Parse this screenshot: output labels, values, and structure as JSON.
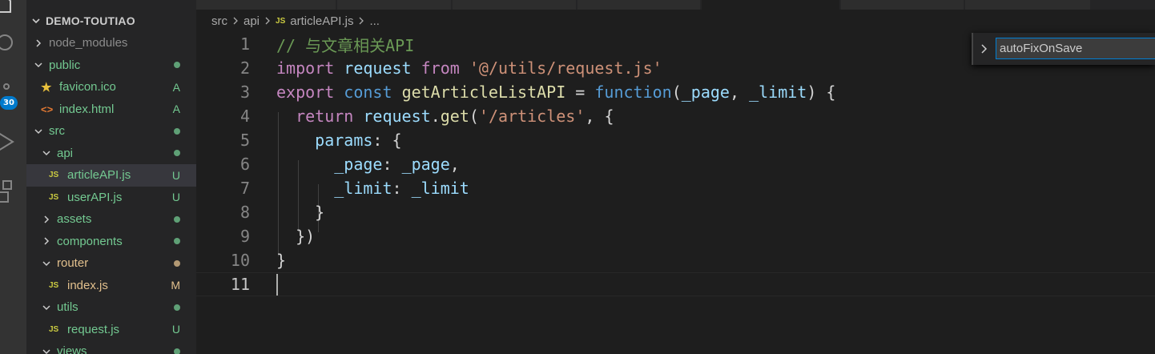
{
  "activity_bar": {
    "scm_badge": "30",
    "icons": [
      "explorer-icon",
      "search-icon",
      "source-control-icon",
      "run-debug-icon",
      "extensions-icon"
    ]
  },
  "explorer": {
    "title": "DEMO-TOUTIAO",
    "items": [
      {
        "label": "node_modules",
        "kind": "folder",
        "expanded": false,
        "depth": 1,
        "status": "",
        "color": "#8c8c8c"
      },
      {
        "label": "public",
        "kind": "folder",
        "expanded": true,
        "depth": 1,
        "status": "dot",
        "color": "#73c991"
      },
      {
        "label": "favicon.ico",
        "kind": "ico",
        "depth": 2,
        "status": "A",
        "color": "#73c991"
      },
      {
        "label": "index.html",
        "kind": "html",
        "depth": 2,
        "status": "A",
        "color": "#73c991"
      },
      {
        "label": "src",
        "kind": "folder",
        "expanded": true,
        "depth": 1,
        "status": "dot",
        "color": "#73c991"
      },
      {
        "label": "api",
        "kind": "folder",
        "expanded": true,
        "depth": 2,
        "status": "dot",
        "color": "#73c991"
      },
      {
        "label": "articleAPI.js",
        "kind": "js",
        "depth": 3,
        "status": "U",
        "color": "#73c991",
        "selected": true
      },
      {
        "label": "userAPI.js",
        "kind": "js",
        "depth": 3,
        "status": "U",
        "color": "#73c991"
      },
      {
        "label": "assets",
        "kind": "folder",
        "expanded": false,
        "depth": 2,
        "status": "dot",
        "color": "#73c991"
      },
      {
        "label": "components",
        "kind": "folder",
        "expanded": false,
        "depth": 2,
        "status": "dot",
        "color": "#73c991"
      },
      {
        "label": "router",
        "kind": "folder",
        "expanded": true,
        "depth": 2,
        "status": "dot",
        "color": "#e2c08d"
      },
      {
        "label": "index.js",
        "kind": "js",
        "depth": 3,
        "status": "M",
        "color": "#e2c08d"
      },
      {
        "label": "utils",
        "kind": "folder",
        "expanded": true,
        "depth": 2,
        "status": "dot",
        "color": "#73c991"
      },
      {
        "label": "request.js",
        "kind": "js",
        "depth": 3,
        "status": "U",
        "color": "#73c991"
      },
      {
        "label": "views",
        "kind": "folder",
        "expanded": true,
        "depth": 2,
        "status": "dot",
        "color": "#73c991"
      }
    ]
  },
  "breadcrumb": {
    "parts": [
      "src",
      "api",
      "articleAPI.js",
      "..."
    ],
    "file_badge": "JS"
  },
  "find_widget": {
    "value": "autoFixOnSave"
  },
  "editor": {
    "current_line": 11,
    "lines": [
      {
        "n": "1",
        "tokens": [
          [
            "c",
            "// 与文章相关API"
          ]
        ]
      },
      {
        "n": "2",
        "tokens": [
          [
            "k",
            "import"
          ],
          [
            "p",
            " "
          ],
          [
            "v",
            "request"
          ],
          [
            "p",
            " "
          ],
          [
            "k",
            "from"
          ],
          [
            "p",
            " "
          ],
          [
            "s",
            "'@/utils/request.js'"
          ]
        ]
      },
      {
        "n": "3",
        "tokens": [
          [
            "k",
            "export"
          ],
          [
            "p",
            " "
          ],
          [
            "d",
            "const"
          ],
          [
            "p",
            " "
          ],
          [
            "f",
            "getArticleListAPI"
          ],
          [
            "p",
            " = "
          ],
          [
            "d",
            "function"
          ],
          [
            "p",
            "("
          ],
          [
            "v",
            "_page"
          ],
          [
            "p",
            ", "
          ],
          [
            "v",
            "_limit"
          ],
          [
            "p",
            ") {"
          ]
        ]
      },
      {
        "n": "4",
        "tokens": [
          [
            "p",
            "  "
          ],
          [
            "k",
            "return"
          ],
          [
            "p",
            " "
          ],
          [
            "v",
            "request"
          ],
          [
            "p",
            "."
          ],
          [
            "f",
            "get"
          ],
          [
            "p",
            "("
          ],
          [
            "s",
            "'/articles'"
          ],
          [
            "p",
            ", {"
          ]
        ]
      },
      {
        "n": "5",
        "tokens": [
          [
            "p",
            "    "
          ],
          [
            "v",
            "params"
          ],
          [
            "p",
            ": {"
          ]
        ]
      },
      {
        "n": "6",
        "tokens": [
          [
            "p",
            "      "
          ],
          [
            "v",
            "_page"
          ],
          [
            "p",
            ": "
          ],
          [
            "v",
            "_page"
          ],
          [
            "p",
            ","
          ]
        ]
      },
      {
        "n": "7",
        "tokens": [
          [
            "p",
            "      "
          ],
          [
            "v",
            "_limit"
          ],
          [
            "p",
            ": "
          ],
          [
            "v",
            "_limit"
          ]
        ]
      },
      {
        "n": "8",
        "tokens": [
          [
            "p",
            "    }"
          ]
        ]
      },
      {
        "n": "9",
        "tokens": [
          [
            "p",
            "  })"
          ]
        ]
      },
      {
        "n": "10",
        "tokens": [
          [
            "p",
            "}"
          ]
        ]
      },
      {
        "n": "11",
        "tokens": []
      }
    ]
  }
}
